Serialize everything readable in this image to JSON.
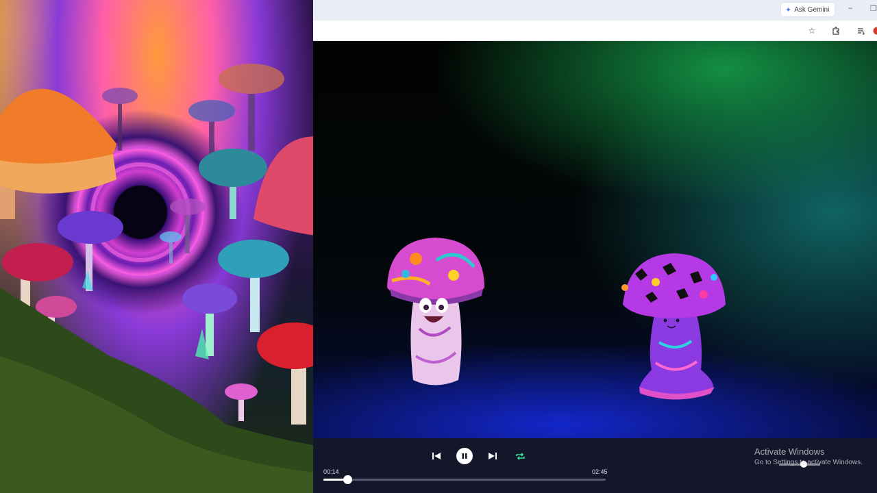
{
  "browser": {
    "gemini_label": "Ask Gemini",
    "minimize_glyph": "–",
    "restore_glyph": "❐",
    "icons": [
      "bookmark-star-icon",
      "extensions-icon",
      "reading-list-icon",
      "profile-icon"
    ]
  },
  "player": {
    "current_time": "00:14",
    "duration": "02:45",
    "progress": 0.085,
    "state": "playing",
    "volume": 0.6,
    "icons": [
      "previous-icon",
      "pause-icon",
      "next-icon",
      "repeat-icon"
    ],
    "accent": "#2ee6a0"
  },
  "os": {
    "watermark_title": "Activate Windows",
    "watermark_sub": "Go to Settings to activate Windows."
  }
}
